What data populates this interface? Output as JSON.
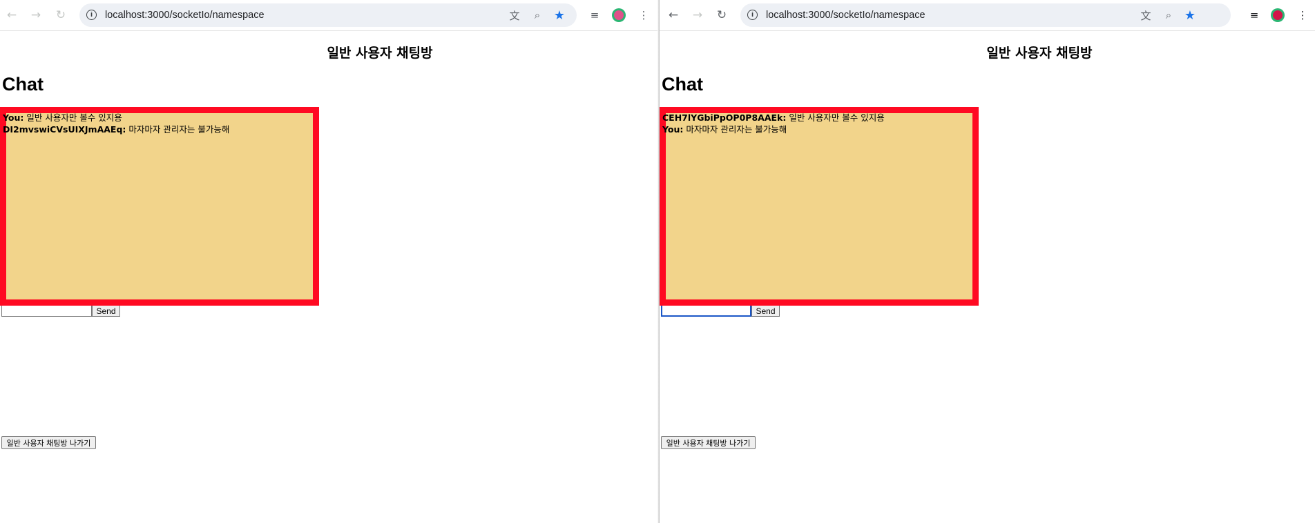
{
  "left": {
    "url": "localhost:3000/socketIo/namespace",
    "page_title": "일반 사용자 채팅방",
    "chat_heading": "Chat",
    "messages": [
      {
        "sender": "You:",
        "text": " 일반 사용자만 볼수 있지용"
      },
      {
        "sender": "DI2mvswiCVsUIXJmAAEq:",
        "text": " 마자마자 관리자는 불가능해"
      }
    ],
    "send_label": "Send",
    "leave_label": "일반 사용자 채팅방 나가기",
    "input_value": ""
  },
  "right": {
    "url": "localhost:3000/socketIo/namespace",
    "page_title": "일반 사용자 채팅방",
    "chat_heading": "Chat",
    "messages": [
      {
        "sender": "CEH7lYGbiPpOP0P8AAEk:",
        "text": " 일반 사용자만 볼수 있지용"
      },
      {
        "sender": "You:",
        "text": " 마자마자 관리자는 불가능해"
      }
    ],
    "send_label": "Send",
    "leave_label": "일반 사용자 채팅방 나가기",
    "input_value": ""
  },
  "icons": {
    "back": "arrow-left-icon",
    "forward": "arrow-right-icon",
    "reload": "reload-icon",
    "info": "info-icon",
    "translate": "translate-icon",
    "zoom": "zoom-icon",
    "bookmark": "star-icon",
    "media": "media-control-icon",
    "menu": "kebab-menu-icon"
  },
  "colors": {
    "chat_border": "#ff0a22",
    "chat_background": "#f2d48b",
    "bookmark_star": "#1a73e8",
    "profile_left": "#e0528a",
    "profile_right": "#d2164a",
    "profile_ring": "#2bb673"
  }
}
